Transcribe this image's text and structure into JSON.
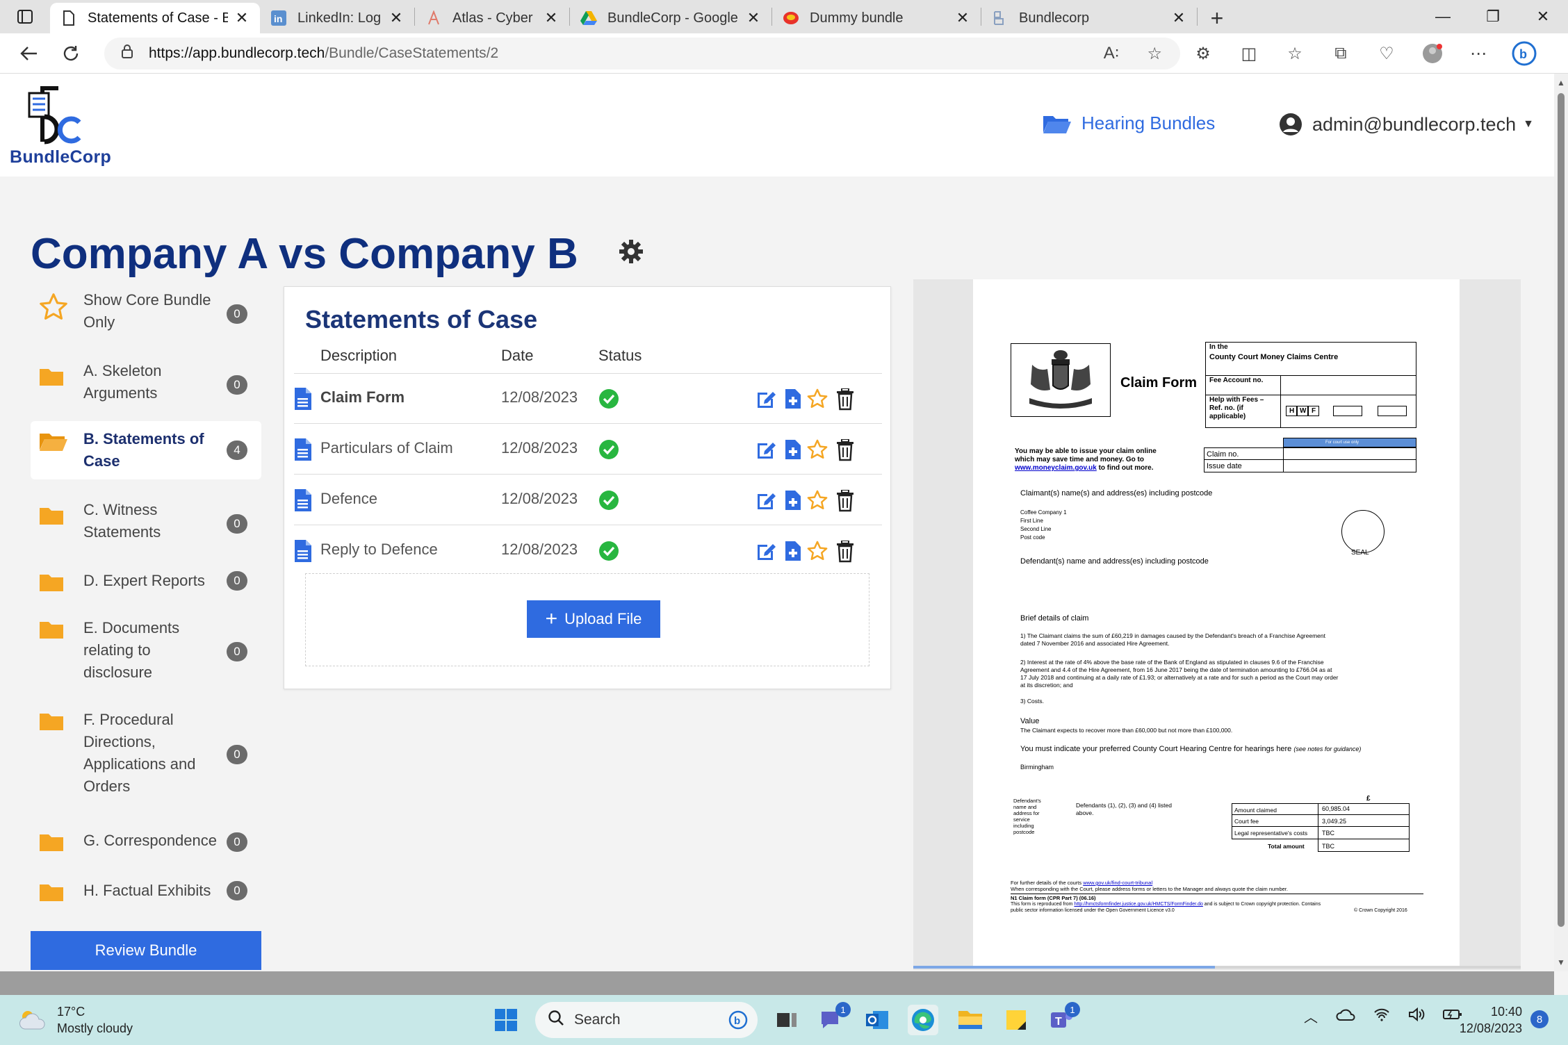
{
  "browser": {
    "tabs": [
      {
        "title": "Statements of Case - Bundl",
        "active": true
      },
      {
        "title": "LinkedIn: Log In or Sign Up",
        "active": false
      },
      {
        "title": "Atlas - Cyber",
        "active": false
      },
      {
        "title": "BundleCorp - Google Drive",
        "active": false
      },
      {
        "title": "Dummy bundle",
        "active": false
      },
      {
        "title": "Bundlecorp",
        "active": false
      }
    ],
    "url_host": "https://app.bundlecorp.tech",
    "url_path": "/Bundle/CaseStatements/2"
  },
  "header": {
    "logo_text": "BundleCorp",
    "nav_hearing": "Hearing Bundles",
    "user_email": "admin@bundlecorp.tech"
  },
  "page": {
    "title": "Company A vs Company B"
  },
  "sidebar": {
    "items": [
      {
        "label": "Show Core Bundle Only",
        "count": "0",
        "icon": "star-icon"
      },
      {
        "label": "A. Skeleton Arguments",
        "count": "0",
        "icon": "folder-icon"
      },
      {
        "label": "B. Statements of Case",
        "count": "4",
        "icon": "folder-open-icon"
      },
      {
        "label": "C. Witness Statements",
        "count": "0",
        "icon": "folder-icon"
      },
      {
        "label": "D. Expert Reports",
        "count": "0",
        "icon": "folder-icon"
      },
      {
        "label": "E. Documents relating to disclosure",
        "count": "0",
        "icon": "folder-icon"
      },
      {
        "label": "F. Procedural Directions, Applications and Orders",
        "count": "0",
        "icon": "folder-icon"
      },
      {
        "label": "G. Correspondence",
        "count": "0",
        "icon": "folder-icon"
      },
      {
        "label": "H. Factual Exhibits",
        "count": "0",
        "icon": "folder-icon"
      }
    ],
    "review_button": "Review Bundle"
  },
  "statements": {
    "title": "Statements of Case",
    "columns": [
      "Description",
      "Date",
      "Status"
    ],
    "rows": [
      {
        "description": "Claim Form",
        "date": "12/08/2023"
      },
      {
        "description": "Particulars of Claim",
        "date": "12/08/2023"
      },
      {
        "description": "Defence",
        "date": "12/08/2023"
      },
      {
        "description": "Reply to Defence",
        "date": "12/08/2023"
      }
    ],
    "upload_label": "Upload File"
  },
  "pdf": {
    "in_the": "In the",
    "court": "County Court Money Claims Centre",
    "form_title": "Claim Form",
    "fee_account": "Fee Account no.",
    "hwf": "Help with Fees – Ref. no. (if applicable)",
    "hwf_letters": [
      "H",
      "W",
      "F"
    ],
    "court_use": "For court use only",
    "claim_no": "Claim no.",
    "issue_date": "Issue date",
    "online_1": "You may be able to issue your claim online",
    "online_2": "which may save time and money. Go to",
    "online_link": "www.moneyclaim.gov.uk",
    "online_3": " to find out more.",
    "claimant_heading": "Claimant(s) name(s) and address(es) including postcode",
    "claimant_lines": [
      "Coffee Company 1",
      "First Line",
      "Second Line",
      "Post code"
    ],
    "seal": "SEAL",
    "defendant_heading": "Defendant(s) name and address(es) including postcode",
    "brief_heading": "Brief details of claim",
    "claim_1": "1) The Claimant claims the sum of £60,219 in damages caused by the Defendant's breach of a Franchise Agreement",
    "claim_1b": "dated 7 November 2016 and associated Hire Agreement.",
    "claim_2": "2)  Interest at the rate of 4% above the base rate of the Bank of England as stipulated in clauses 9.6 of the Franchise",
    "claim_2b": "Agreement and 4.4 of the Hire Agreement, from 16 June 2017 being the date of termination amounting to £766.04 as at",
    "claim_2c": "17 July 2018 and continuing at a daily rate of £1.93; or alternatively at a rate and for such a period as the Court may order",
    "claim_2d": "at its discretion; and",
    "claim_3": "3)  Costs.",
    "value_heading": "Value",
    "value_text": "The Claimant expects to recover more than £60,000 but not more than £100,000.",
    "hearing_text": "You must indicate your preferred County Court Hearing Centre for hearings here",
    "hearing_note": "(see notes for guidance)",
    "hearing_centre": "Birmingham",
    "def_service": [
      "Defendant's",
      "name and",
      "address for",
      "service",
      "including",
      "postcode"
    ],
    "def_listed": "Defendants (1), (2), (3) and (4) listed",
    "def_listed_b": "above.",
    "currency": "£",
    "amounts": [
      {
        "label": "Amount claimed",
        "value": "60,985.04"
      },
      {
        "label": "Court fee",
        "value": "3,049.25"
      },
      {
        "label": "Legal representative's costs",
        "value": "TBC"
      },
      {
        "label": "Total amount",
        "value": "TBC"
      }
    ],
    "footer_1": "For further details of the courts ",
    "footer_1_link": "www.gov.uk/find-court-tribunal",
    "footer_2": "When corresponding with the Court, please address forms or letters to the Manager and always quote the claim number.",
    "footer_3": "N1 Claim form (CPR Part 7) (06.16)",
    "footer_4": "This form is reproduced from ",
    "footer_4_link": "http://hmctsformfinder.justice.gov.uk/HMCTS/FormFinder.do",
    "footer_4b": " and is subject to Crown copyright protection.  Contains",
    "footer_5": "public sector information licensed under the Open Government Licence v3.0",
    "footer_copyright": "© Crown Copyright 2016"
  },
  "taskbar": {
    "temp": "17°C",
    "condition": "Mostly cloudy",
    "search_label": "Search",
    "time": "10:40",
    "date": "12/08/2023",
    "notif_count": "8",
    "teams_badge": "1",
    "chat_badge": "1"
  },
  "colors": {
    "primary": "#2f6be0",
    "title": "#0f2f7e",
    "folder": "#f5a623",
    "success": "#28b640"
  }
}
